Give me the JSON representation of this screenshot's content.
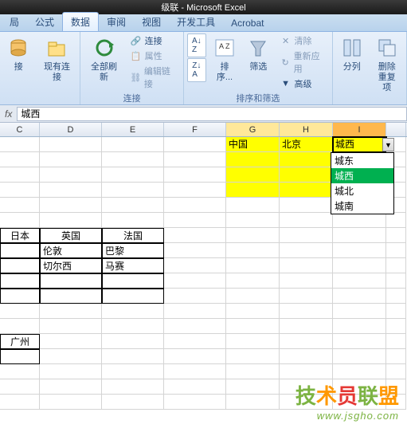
{
  "title": "级联 - Microsoft Excel",
  "tabs": [
    "局",
    "公式",
    "数据",
    "审阅",
    "视图",
    "开发工具",
    "Acrobat"
  ],
  "active_tab": 2,
  "ribbon": {
    "g1": {
      "btn1": "接\n",
      "btn2": "现有连接",
      "label": ""
    },
    "g2": {
      "btn": "全部刷新",
      "s1": "连接",
      "s2": "属性",
      "s3": "编辑链接",
      "label": "连接"
    },
    "g3": {
      "btn": "排序...",
      "s1": "清除",
      "s2": "重新应用",
      "s3": "高级",
      "filter": "筛选",
      "label": "排序和筛选"
    },
    "g4": {
      "btn1": "分列",
      "btn2": "删除\n重复项",
      "label": ""
    }
  },
  "formula": {
    "fx": "fx",
    "value": "城西"
  },
  "cols": [
    "C",
    "D",
    "E",
    "F",
    "G",
    "H",
    "I"
  ],
  "widths": [
    50,
    78,
    78,
    78,
    67,
    67,
    67
  ],
  "ydata": {
    "g": "中国",
    "h": "北京",
    "i": "城西"
  },
  "dropdown": [
    "城东",
    "城西",
    "城北",
    "城南"
  ],
  "dd_selected": 1,
  "table1": {
    "h1": "日本",
    "h2": "英国",
    "h3": "法国",
    "r1c1": "",
    "r1c2": "伦敦",
    "r1c3": "巴黎",
    "r2c1": "",
    "r2c2": "切尔西",
    "r2c3": "马赛"
  },
  "table2": {
    "h": "广州",
    "r": ""
  },
  "watermark": {
    "text": "技术员联盟",
    "url": "www.jsgho.com"
  }
}
